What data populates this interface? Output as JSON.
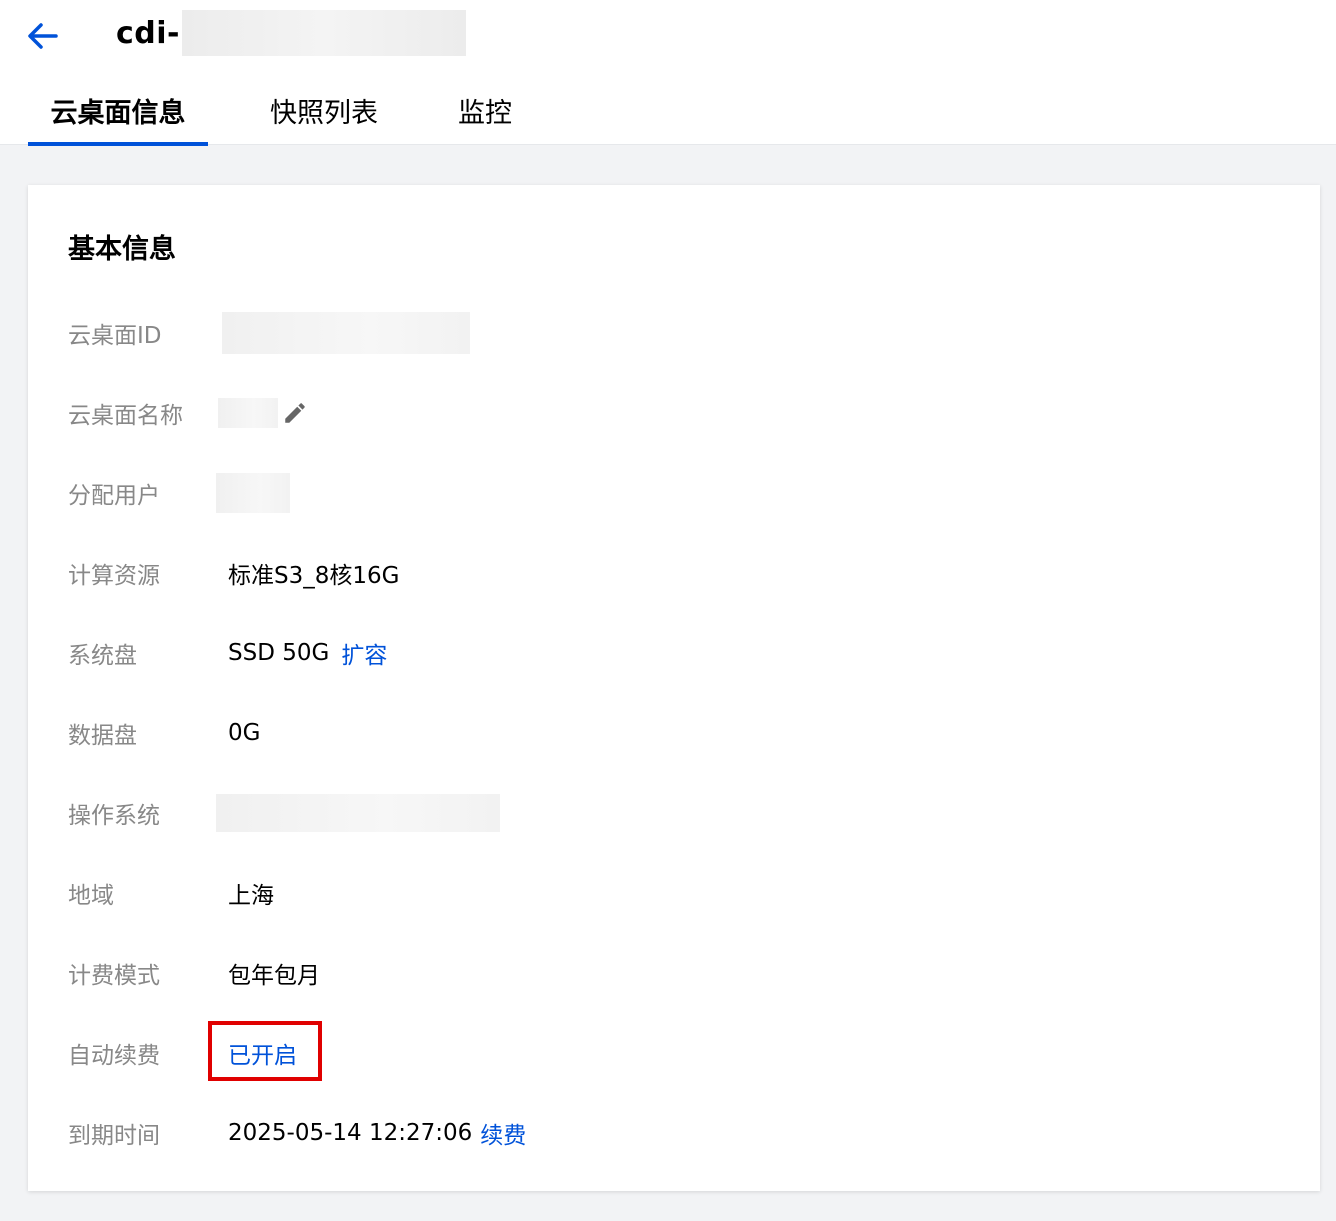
{
  "header": {
    "title_visible": "cdi-",
    "back_icon": "arrow-left-icon"
  },
  "tabs": [
    {
      "label": "云桌面信息",
      "active": true
    },
    {
      "label": "快照列表",
      "active": false
    },
    {
      "label": "监控",
      "active": false
    }
  ],
  "basic_info": {
    "section_title": "基本信息",
    "desktop_id": {
      "label": "云桌面ID"
    },
    "desktop_name": {
      "label": "云桌面名称",
      "edit_icon": "pencil-icon"
    },
    "assigned_user": {
      "label": "分配用户"
    },
    "compute": {
      "label": "计算资源",
      "value": "标准S3_8核16G"
    },
    "system_disk": {
      "label": "系统盘",
      "value": "SSD 50G",
      "action": "扩容"
    },
    "data_disk": {
      "label": "数据盘",
      "value": "0G"
    },
    "os": {
      "label": "操作系统"
    },
    "region": {
      "label": "地域",
      "value": "上海"
    },
    "billing_mode": {
      "label": "计费模式",
      "value": "包年包月"
    },
    "auto_renew": {
      "label": "自动续费",
      "value": "已开启"
    },
    "expire_time": {
      "label": "到期时间",
      "value": "2025-05-14 12:27:06",
      "action": "续费"
    }
  },
  "colors": {
    "accent": "#0052d9",
    "highlight_border": "#e00000",
    "label_gray": "#888888"
  }
}
